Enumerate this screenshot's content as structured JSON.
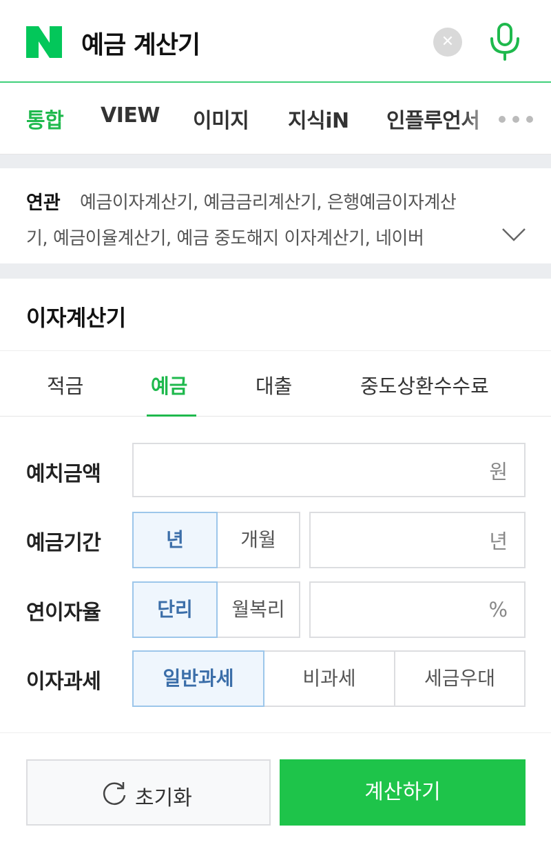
{
  "search": {
    "query": "예금 계산기",
    "clear_glyph": "✕",
    "logo_letter": "N",
    "accent": "#1fb94d"
  },
  "nav_tabs": [
    {
      "label": "통합",
      "active": true
    },
    {
      "label": "VIEW"
    },
    {
      "label": "이미지"
    },
    {
      "label": "지식iN"
    },
    {
      "label": "인플루언서"
    }
  ],
  "related": {
    "label": "연관",
    "line1": "예금이자계산기, 예금금리계산기, 은행예금이자계산",
    "line2": "기, 예금이율계산기, 예금 중도해지 이자계산기, 네이버"
  },
  "calculator": {
    "title": "이자계산기",
    "tabs": [
      {
        "label": "적금"
      },
      {
        "label": "예금",
        "active": true
      },
      {
        "label": "대출"
      },
      {
        "label": "중도상환수수료"
      }
    ],
    "deposit_amount": {
      "label": "예치금액",
      "unit": "원"
    },
    "period": {
      "label": "예금기간",
      "options": [
        "년",
        "개월"
      ],
      "selected": "년",
      "unit": "년"
    },
    "rate": {
      "label": "연이자율",
      "options": [
        "단리",
        "월복리"
      ],
      "selected": "단리",
      "unit": "%"
    },
    "tax": {
      "label": "이자과세",
      "options": [
        "일반과세",
        "비과세",
        "세금우대"
      ],
      "selected": "일반과세"
    },
    "reset_label": "초기화",
    "calculate_label": "계산하기"
  }
}
